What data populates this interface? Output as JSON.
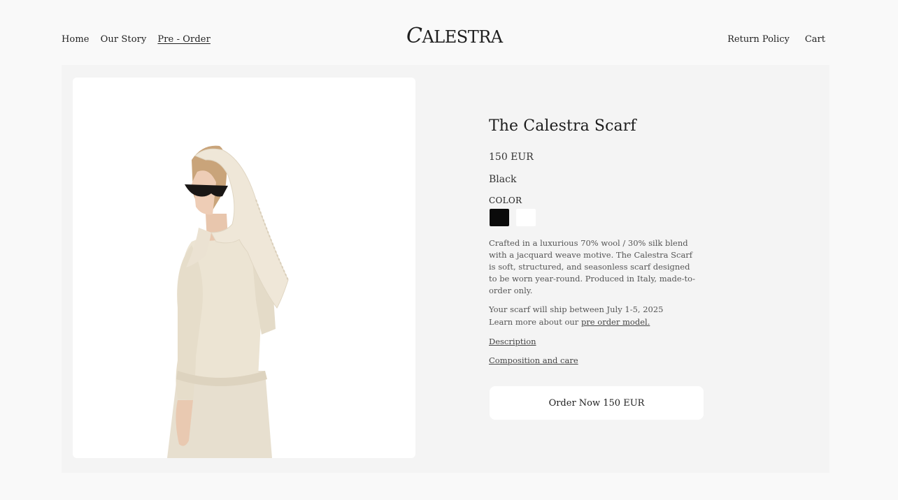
{
  "header": {
    "nav_left": [
      "Home",
      "Our Story",
      "Pre - Order"
    ],
    "logo_initial": "C",
    "logo_rest": "ALESTRA",
    "nav_right": [
      "Return Policy",
      "Cart"
    ]
  },
  "product": {
    "title": "The Calestra Scarf",
    "price": "150 EUR",
    "color_selected": "Black",
    "color_label": "COLOR",
    "swatches": [
      {
        "name": "Black",
        "hex": "#0b0b0b"
      },
      {
        "name": "White",
        "hex": "#ffffff"
      }
    ],
    "description": "Crafted in a luxurious 70% wool / 30% silk blend with a jacquard weave motive. The Calestra Scarf is soft, structured, and seasonless scarf designed to be worn year-round. Produced in Italy, made-to-order only.",
    "ship_text": "Your scarf will ship between July 1-5, 2025",
    "learn_prefix": "Learn more about our ",
    "learn_link": "pre order model.",
    "link_description": "Description",
    "link_composition": "Composition and care",
    "order_button": "Order Now 150 EUR"
  },
  "colors": {
    "background": "#f9f9f9",
    "panel": "#f4f4f4",
    "card": "#ffffff",
    "text": "#222222"
  },
  "icons": {
    "product_image": "woman-in-cream-scarf-and-sunglasses"
  }
}
